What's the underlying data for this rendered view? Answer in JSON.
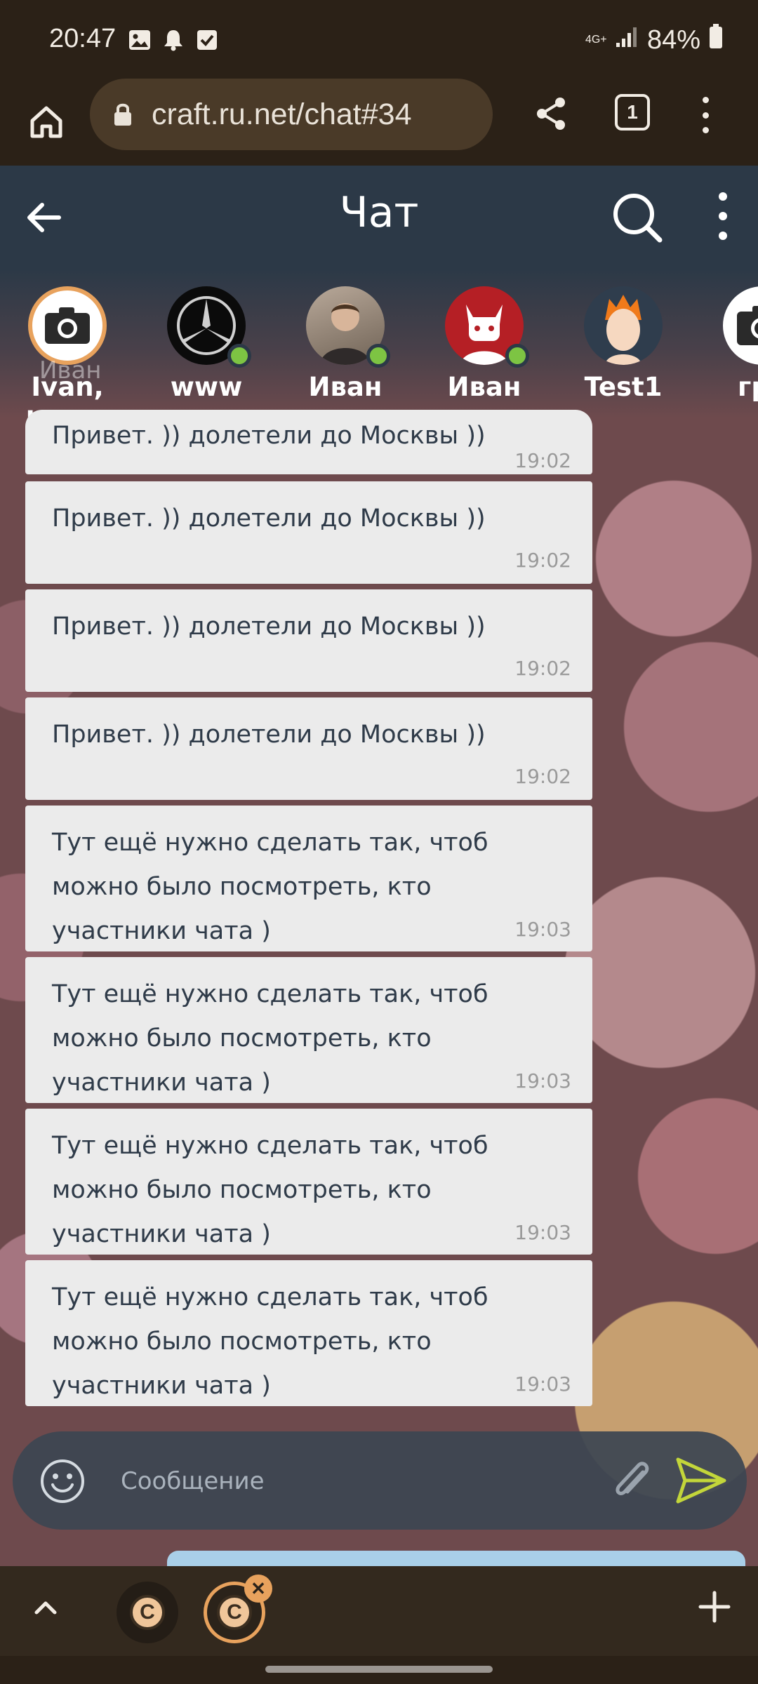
{
  "status_bar": {
    "time": "20:47",
    "network": "4G+",
    "battery": "84%",
    "icons": [
      "gallery-icon",
      "bell-icon",
      "checkbox-icon"
    ]
  },
  "browser": {
    "url": "craft.ru.net/chat#34",
    "tab_count": "1"
  },
  "chat": {
    "title": "Чат"
  },
  "participants": [
    {
      "name": "Ivan, Иван,",
      "avatar": "camera",
      "online": false,
      "selected": true,
      "overlay": "Иван"
    },
    {
      "name": "www",
      "avatar": "mercedes",
      "online": true,
      "selected": false
    },
    {
      "name": "Иван",
      "avatar": "photo-man",
      "online": true,
      "selected": false
    },
    {
      "name": "Иван Номер",
      "avatar": "red-animal",
      "online": true,
      "selected": false
    },
    {
      "name": "Test1",
      "avatar": "orange-hair",
      "online": false,
      "selected": false
    },
    {
      "name": "гру",
      "avatar": "camera",
      "online": false,
      "selected": false
    }
  ],
  "messages": [
    {
      "text": "Привет. )) долетели до Москвы ))",
      "time": "19:02"
    },
    {
      "text": "Привет. )) долетели до Москвы ))",
      "time": "19:02"
    },
    {
      "text": "Привет. )) долетели до Москвы ))",
      "time": "19:02"
    },
    {
      "text": "Привет. )) долетели до Москвы ))",
      "time": "19:02"
    },
    {
      "text": "Тут ещё нужно сделать так, чтоб можно было посмотреть, кто участники чата )",
      "time": "19:03"
    },
    {
      "text": "Тут ещё нужно сделать так, чтоб можно было посмотреть, кто участники чата )",
      "time": "19:03"
    },
    {
      "text": "Тут ещё нужно сделать так, чтоб можно было посмотреть, кто участники чата )",
      "time": "19:03"
    },
    {
      "text": "Тут ещё нужно сделать так, чтоб можно было посмотреть, кто участники чата )",
      "time": "19:03"
    }
  ],
  "composer": {
    "placeholder": "Сообщение"
  },
  "tabs_bar": {
    "tab_letter": "C",
    "close_symbol": "✕"
  },
  "colors": {
    "header": "#2c3947",
    "online": "#7dc443",
    "send": "#c3d63a",
    "accent_tab": "#e8a25d"
  }
}
